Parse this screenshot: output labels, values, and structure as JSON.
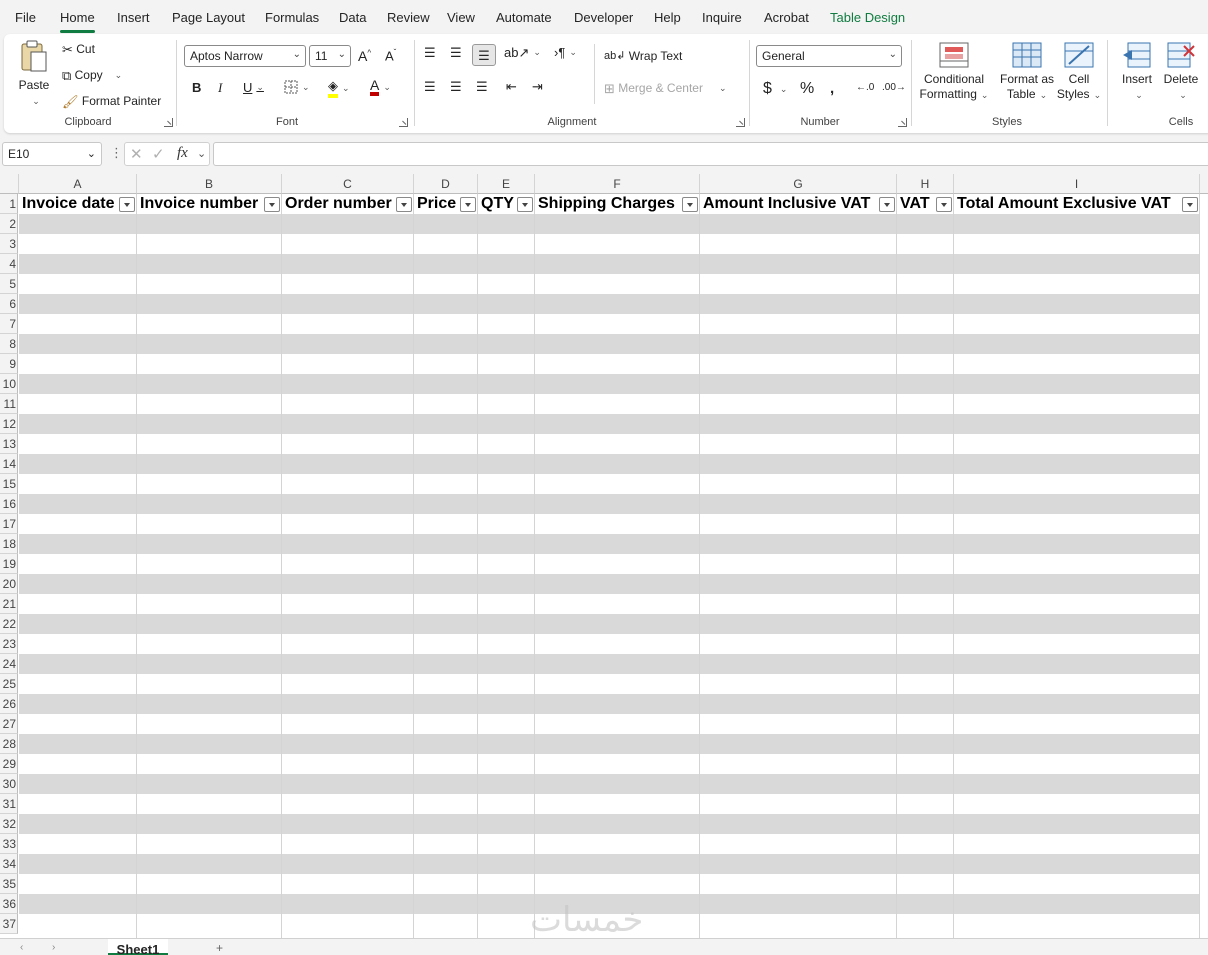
{
  "menu": {
    "tabs": [
      "File",
      "Home",
      "Insert",
      "Page Layout",
      "Formulas",
      "Data",
      "Review",
      "View",
      "Automate",
      "Developer",
      "Help",
      "Inquire",
      "Acrobat",
      "Table Design"
    ],
    "active": "Home"
  },
  "ribbon": {
    "clipboard": {
      "paste": "Paste",
      "cut": "Cut",
      "copy": "Copy",
      "format_painter": "Format Painter",
      "label": "Clipboard"
    },
    "font": {
      "name": "Aptos Narrow",
      "size": "11",
      "label": "Font"
    },
    "alignment": {
      "wrap_text": "Wrap Text",
      "merge_center": "Merge & Center",
      "label": "Alignment"
    },
    "number": {
      "format": "General",
      "label": "Number"
    },
    "styles": {
      "conditional": [
        "Conditional",
        "Formatting"
      ],
      "format_table": [
        "Format as",
        "Table"
      ],
      "cell_styles": [
        "Cell",
        "Styles"
      ],
      "label": "Styles"
    },
    "cells": {
      "insert": "Insert",
      "delete": "Delete",
      "label": "Cells"
    }
  },
  "formula_bar": {
    "name_box": "E10",
    "fx": "fx",
    "formula": ""
  },
  "columns": [
    "A",
    "B",
    "C",
    "D",
    "E",
    "F",
    "G",
    "H",
    "I"
  ],
  "table_headers": [
    "Invoice date",
    "Invoice number",
    "Order number",
    "Price",
    "QTY",
    "Shipping Charges",
    "Amount Inclusive VAT",
    "VAT",
    "Total Amount Exclusive VAT"
  ],
  "rows": [
    "1",
    "2",
    "3",
    "4",
    "5",
    "6",
    "7",
    "8",
    "9",
    "10",
    "11",
    "12",
    "13",
    "14",
    "15",
    "16",
    "17",
    "18",
    "19",
    "20",
    "21",
    "22",
    "23",
    "24",
    "25",
    "26",
    "27",
    "28",
    "29",
    "30",
    "31",
    "32",
    "33",
    "34",
    "35",
    "36",
    "37"
  ],
  "sheet": {
    "name": "Sheet1"
  },
  "watermark": "خمسات",
  "colors": {
    "accent": "#107c41",
    "band": "#d9d9d9"
  }
}
